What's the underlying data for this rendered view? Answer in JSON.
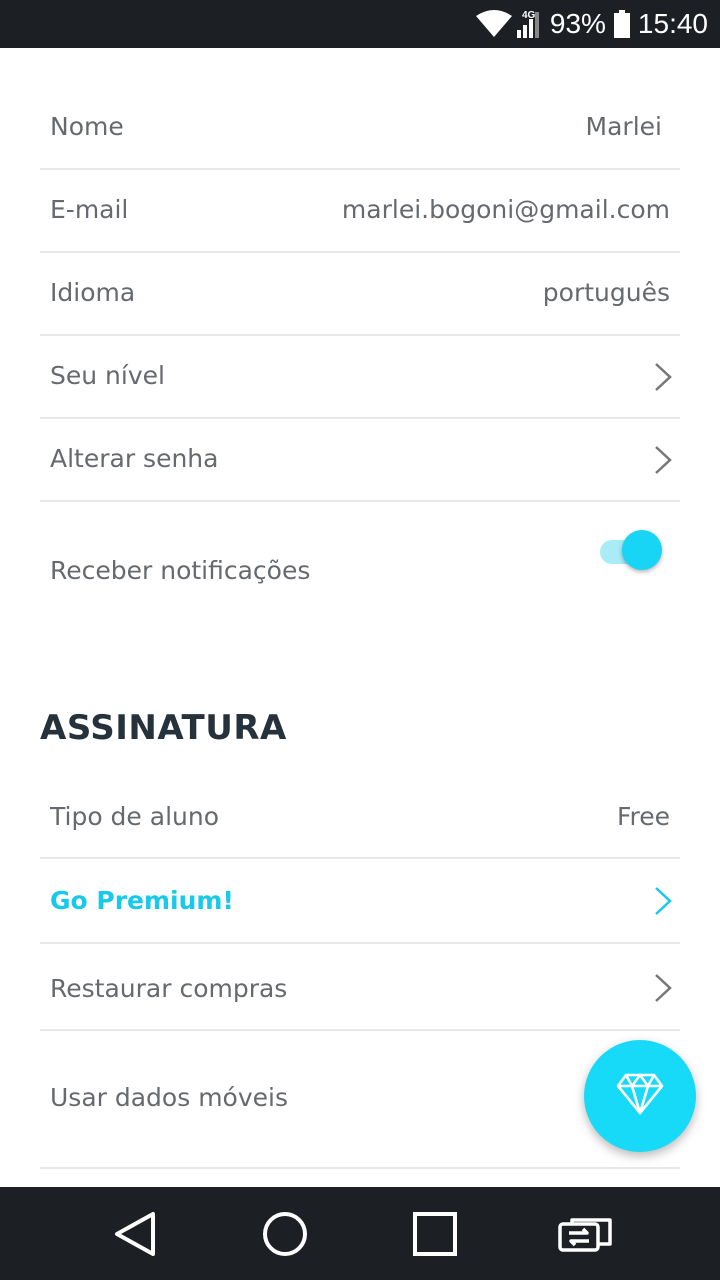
{
  "status_bar": {
    "wifi_icon": "wifi-icon",
    "network_type": "4G",
    "signal_icon": "signal-icon",
    "battery_percent": "93%",
    "battery_icon": "battery-icon",
    "time": "15:40"
  },
  "profile": {
    "name_label": "Nome",
    "name_value": "Marlei",
    "email_label": "E-mail",
    "email_value": "marlei.bogoni@gmail.com",
    "language_label": "Idioma",
    "language_value": "português",
    "level_label": "Seu nível",
    "change_password_label": "Alterar senha",
    "notifications_label": "Receber notificações",
    "notifications_on": true
  },
  "subscription": {
    "section_title": "ASSINATURA",
    "student_type_label": "Tipo de aluno",
    "student_type_value": "Free",
    "go_premium_label": "Go Premium!",
    "restore_purchases_label": "Restaurar compras",
    "mobile_data_label": "Usar dados móveis"
  },
  "fab": {
    "icon": "diamond-icon"
  },
  "nav_bar": {
    "back_icon": "back-triangle-icon",
    "home_icon": "home-circle-icon",
    "recents_icon": "recents-square-icon",
    "switch_icon": "switch-apps-icon"
  },
  "colors": {
    "accent": "#18d4f5",
    "premium_text": "#18c9e9",
    "bar_background": "#1c1f24",
    "section_title": "#26323b"
  }
}
